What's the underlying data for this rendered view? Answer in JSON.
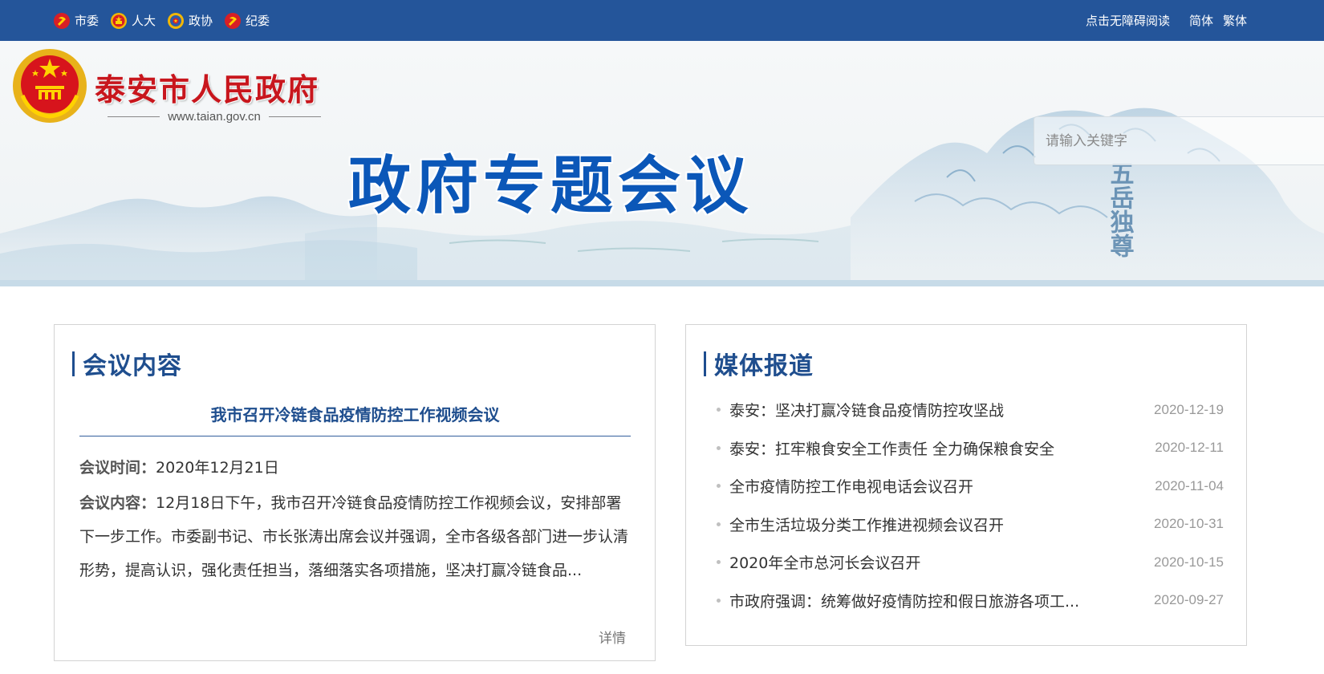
{
  "topbar": {
    "links": [
      {
        "label": "市委",
        "icon": "party-emblem-icon"
      },
      {
        "label": "人大",
        "icon": "national-emblem-icon"
      },
      {
        "label": "政协",
        "icon": "cppcc-emblem-icon"
      },
      {
        "label": "纪委",
        "icon": "party-emblem-icon"
      }
    ],
    "accessibility_label": "点击无障碍阅读",
    "simplified_label": "简体",
    "traditional_label": "繁体"
  },
  "header": {
    "site_name": "泰安市人民政府",
    "site_url": "www.taian.gov.cn",
    "page_title": "政府专题会议",
    "calligraphy_text": "五岳独尊",
    "logo_icon": "national-emblem-icon"
  },
  "search": {
    "placeholder": "请输入关键字"
  },
  "meeting_panel": {
    "heading": "会议内容",
    "news_title": "我市召开冷链食品疫情防控工作视频会议",
    "time_label": "会议时间：",
    "time_value": "2020年12月21日",
    "content_label": "会议内容：",
    "content_text": "12月18日下午，我市召开冷链食品疫情防控工作视频会议，安排部署下一步工作。市委副书记、市长张涛出席会议并强调，全市各级各部门进一步认清形势，提高认识，强化责任担当，落细落实各项措施，坚决打赢冷链食品...",
    "more_label": "详情"
  },
  "media_panel": {
    "heading": "媒体报道",
    "items": [
      {
        "title": "泰安：坚决打赢冷链食品疫情防控攻坚战",
        "date": "2020-12-19"
      },
      {
        "title": "泰安：扛牢粮食安全工作责任 全力确保粮食安全",
        "date": "2020-12-11"
      },
      {
        "title": "全市疫情防控工作电视电话会议召开",
        "date": "2020-11-04"
      },
      {
        "title": "全市生活垃圾分类工作推进视频会议召开",
        "date": "2020-10-31"
      },
      {
        "title": "2020年全市总河长会议召开",
        "date": "2020-10-15"
      },
      {
        "title": "市政府强调：统筹做好疫情防控和假日旅游各项工...",
        "date": "2020-09-27"
      }
    ]
  },
  "colors": {
    "topbar": "#24559a",
    "heading": "#1f4e8e",
    "page_title": "#0b57b8",
    "site_name": "#c8161d"
  }
}
